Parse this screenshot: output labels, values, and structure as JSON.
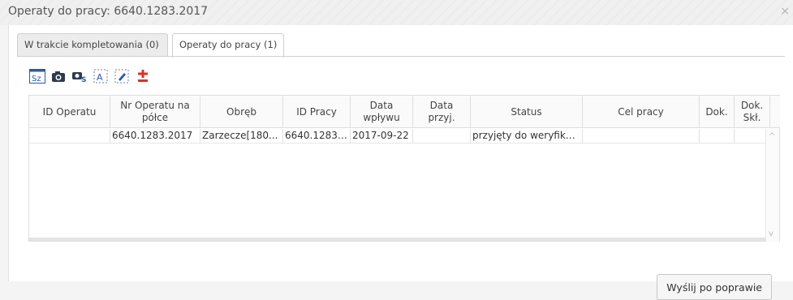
{
  "window": {
    "title": "Operaty do pracy: 6640.1283.2017",
    "close_glyph": "×"
  },
  "tabs": [
    {
      "label": "W trakcie kompletowania (0)",
      "active": false
    },
    {
      "label": "Operaty do pracy (1)",
      "active": true
    }
  ],
  "toolbar": {
    "icons": [
      "sz-icon",
      "camera-icon",
      "camera-s-icon",
      "text-select-icon",
      "edit-select-icon",
      "plus-minus-icon"
    ],
    "sz_label": "Sz",
    "accent_red": "#d9312b",
    "accent_blue": "#2b5aa6"
  },
  "grid": {
    "columns": [
      "ID Operatu",
      "Nr Operatu na półce",
      "Obręb",
      "ID Pracy",
      "Data wpływu",
      "Data przyj.",
      "Status",
      "Cel pracy",
      "Dok.",
      "Dok. Skł."
    ],
    "rows": [
      [
        "",
        "6640.1283.2017",
        "Zarzecze[180...",
        "6640.1283....",
        "2017-09-22",
        "",
        "przyjęty do weryfikacji",
        "",
        "",
        ""
      ]
    ]
  },
  "scrollbar": {
    "up": "^",
    "down": "v"
  },
  "footer": {
    "send_button": "Wyślij po poprawie"
  }
}
